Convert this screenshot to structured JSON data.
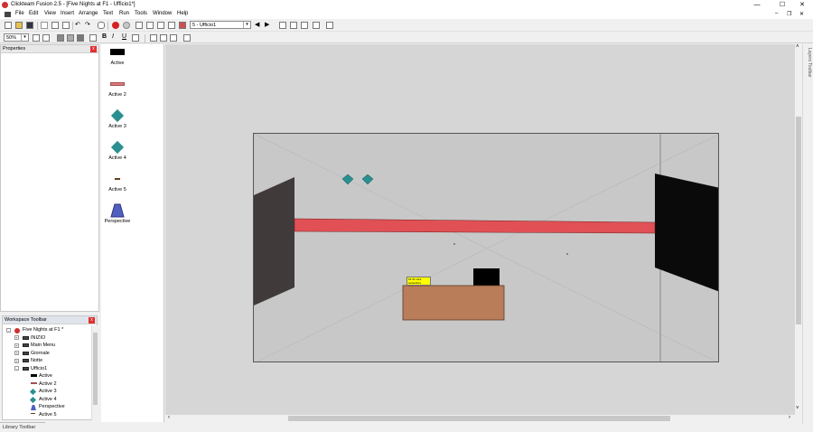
{
  "window": {
    "title": "Clickteam Fusion 2.5 - [Five Nights at F1 - Ufficio1*]",
    "minimize": "—",
    "maximize": "☐",
    "close": "✕",
    "doc_minimize": "–",
    "doc_restore": "❐",
    "doc_close": "✕"
  },
  "menu": [
    "File",
    "Edit",
    "View",
    "Insert",
    "Arrange",
    "Text",
    "Run",
    "Tools",
    "Window",
    "Help"
  ],
  "toolbar": {
    "frame_select": "5 - Ufficio1",
    "zoom": "50%",
    "bold": "B",
    "italic": "I",
    "underline": "U"
  },
  "properties_panel": {
    "title": "Properties",
    "close": "x"
  },
  "objects": [
    {
      "label": "Active",
      "icon": "black-rect-icon"
    },
    {
      "label": "Active 2",
      "icon": "red-bar-icon"
    },
    {
      "label": "Active 3",
      "icon": "teal-diamond-icon"
    },
    {
      "label": "Active 4",
      "icon": "teal-diamond-icon"
    },
    {
      "label": "Active 5",
      "icon": "small-line-icon"
    },
    {
      "label": "Perspective",
      "icon": "perspective-icon"
    }
  ],
  "workspace": {
    "title": "Workspace Toolbar",
    "close": "x",
    "tree": [
      {
        "label": "Five Nights at F1 *",
        "indent": 0,
        "expander": "-",
        "icon": "app-icon"
      },
      {
        "label": "INIZIO",
        "indent": 1,
        "expander": "+",
        "icon": "frame-icon"
      },
      {
        "label": "Main Menu",
        "indent": 1,
        "expander": "+",
        "icon": "frame-icon"
      },
      {
        "label": "Giornale",
        "indent": 1,
        "expander": "+",
        "icon": "frame-icon"
      },
      {
        "label": "Notte",
        "indent": 1,
        "expander": "+",
        "icon": "frame-icon"
      },
      {
        "label": "Ufficio1",
        "indent": 1,
        "expander": "-",
        "icon": "frame-icon"
      },
      {
        "label": "Active",
        "indent": 2,
        "expander": "",
        "icon": "black-rect-icon"
      },
      {
        "label": "Active 2",
        "indent": 2,
        "expander": "",
        "icon": "red-bar-icon"
      },
      {
        "label": "Active 3",
        "indent": 2,
        "expander": "",
        "icon": "teal-diamond-icon"
      },
      {
        "label": "Active 4",
        "indent": 2,
        "expander": "",
        "icon": "teal-diamond-icon"
      },
      {
        "label": "Perspective",
        "indent": 2,
        "expander": "",
        "icon": "perspective-icon"
      },
      {
        "label": "Active 5",
        "indent": 2,
        "expander": "",
        "icon": "small-line-icon"
      }
    ]
  },
  "library_tab": "Library Toolbar",
  "layers_tab": "Layers Toolbar",
  "scene": {
    "sticky_note_text": "Mr #1 ultra sedentibra",
    "colors": {
      "frame_bg": "#c8c8c8",
      "red_bar": "#e05055",
      "desk": "#b97d5a",
      "teal": "#2a8f8f",
      "left_door": "#403a3a",
      "right_door": "#0a0a0a",
      "note": "#ffff00"
    }
  }
}
